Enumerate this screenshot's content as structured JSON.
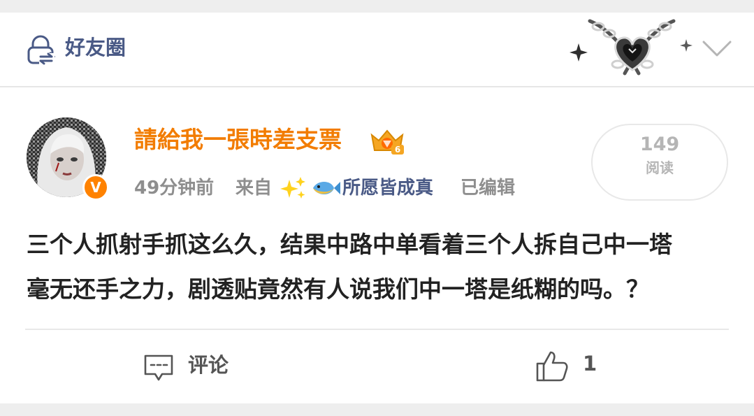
{
  "header": {
    "circle_label": "好友圈",
    "icons": {
      "circle": "lock-people-icon",
      "collapse": "chevron-down-icon",
      "decoration": "heart-chain-decoration-icon"
    }
  },
  "post": {
    "username": "請給我一張時差支票",
    "time": "49分钟前",
    "from_label": "来自",
    "source": "所愿皆成真",
    "edited": "已编辑",
    "verified_mark": "V",
    "views": {
      "count": "149",
      "label": "阅读"
    },
    "body_lines": [
      "三个人抓射手抓这么久，结果中路中单看着三个人拆自己中一塔",
      "毫无还手之力，剧透贴竟然有人说我们中一塔是纸糊的吗。？"
    ],
    "colors": {
      "username": "#f27c00",
      "link": "#4a5a86",
      "meta": "#8e8e8e"
    }
  },
  "actions": {
    "comment_label": "评论",
    "like_count": "1"
  }
}
